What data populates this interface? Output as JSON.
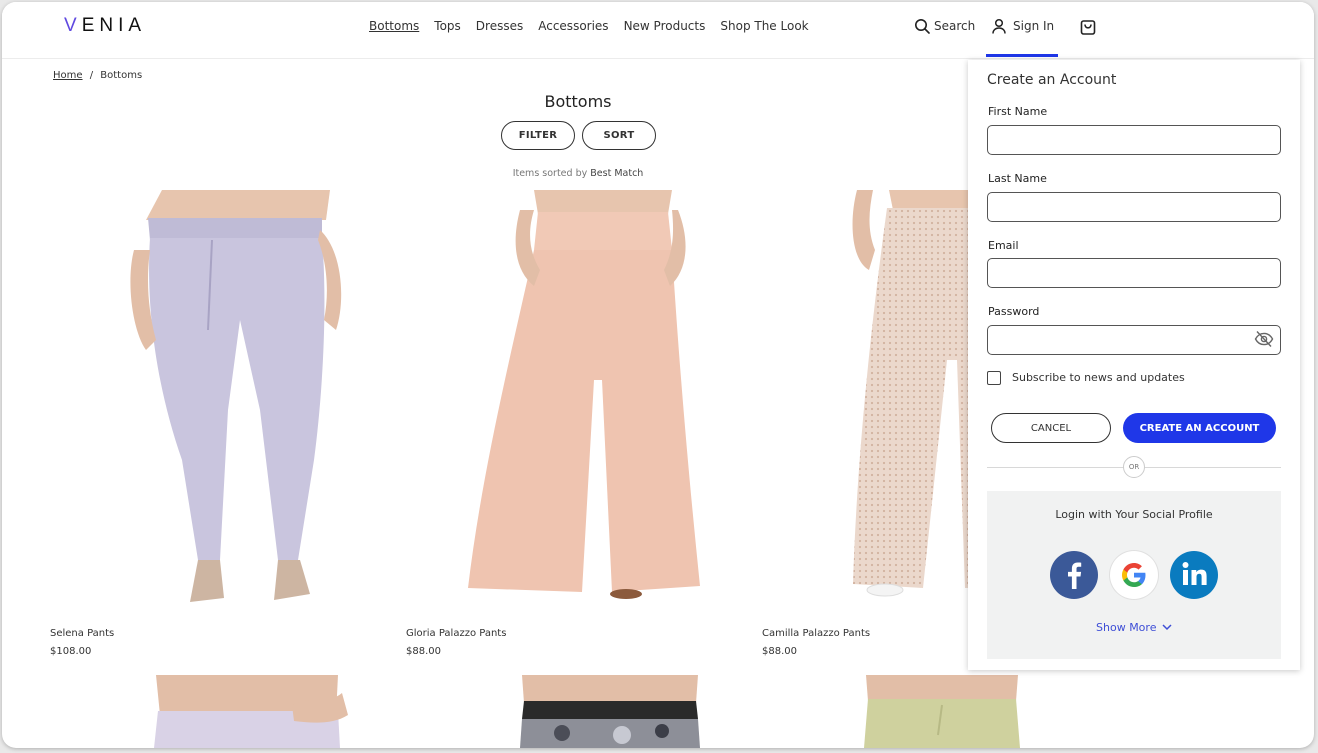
{
  "header": {
    "logo": "VENIA",
    "nav": [
      "Bottoms",
      "Tops",
      "Dresses",
      "Accessories",
      "New Products",
      "Shop The Look"
    ],
    "active_nav": "Bottoms",
    "search_label": "Search",
    "signin_label": "Sign In",
    "accent": "#1f37e8"
  },
  "breadcrumb": {
    "home": "Home",
    "separator": "/",
    "current": "Bottoms"
  },
  "category": {
    "title": "Bottoms",
    "filter_label": "FILTER",
    "sort_label": "SORT",
    "sorted_prefix": "Items sorted by",
    "sorted_value": "Best Match"
  },
  "products": [
    {
      "name": "Selena Pants",
      "price": "$108.00",
      "color": "#c7c3dc"
    },
    {
      "name": "Gloria Palazzo Pants",
      "price": "$88.00",
      "color": "#efc7b4"
    },
    {
      "name": "Camilla Palazzo Pants",
      "price": "$88.00",
      "color": "#ead4c8"
    },
    {
      "name": "",
      "price": "",
      "color": "#d9d2e6"
    },
    {
      "name": "",
      "price": "",
      "color": "#2c2c2c"
    },
    {
      "name": "",
      "price": "",
      "color": "#cfd19e"
    }
  ],
  "account_form": {
    "title": "Create an Account",
    "first_name_label": "First Name",
    "first_name_value": "",
    "last_name_label": "Last Name",
    "last_name_value": "",
    "email_label": "Email",
    "email_value": "",
    "password_label": "Password",
    "password_value": "",
    "subscribe_label": "Subscribe to news and updates",
    "subscribe_checked": false,
    "cancel_label": "CANCEL",
    "create_label": "CREATE AN ACCOUNT",
    "or_label": "OR",
    "social_title": "Login with Your Social Profile",
    "social_icons": [
      "facebook-icon",
      "google-icon",
      "linkedin-icon"
    ],
    "show_more": "Show More"
  }
}
